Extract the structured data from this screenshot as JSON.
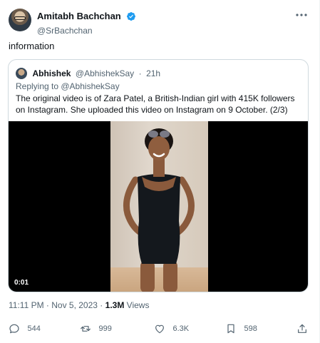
{
  "author": {
    "display_name": "Amitabh Bachchan",
    "handle": "@SrBachchan",
    "avatar_icon": "user-avatar",
    "verified_color": "#1d9bf0"
  },
  "tweet": {
    "text": "information"
  },
  "quote": {
    "author_name": "Abhishek",
    "author_handle": "@AbhishekSay",
    "separator": "·",
    "time": "21h",
    "reply_to": "Replying to @AbhishekSay",
    "text": "The original video is of Zara Patel, a British-Indian girl with 415K followers on Instagram. She uploaded this video on Instagram on 9 October. (2/3)",
    "video": {
      "duration": "0:01"
    }
  },
  "meta": {
    "timestamp": "11:11 PM · Nov 5, 2023 ·",
    "views_count": "1.3M",
    "views_label": "Views"
  },
  "actions": {
    "replies": "544",
    "retweets": "999",
    "likes": "6.3K",
    "bookmarks": "598"
  }
}
